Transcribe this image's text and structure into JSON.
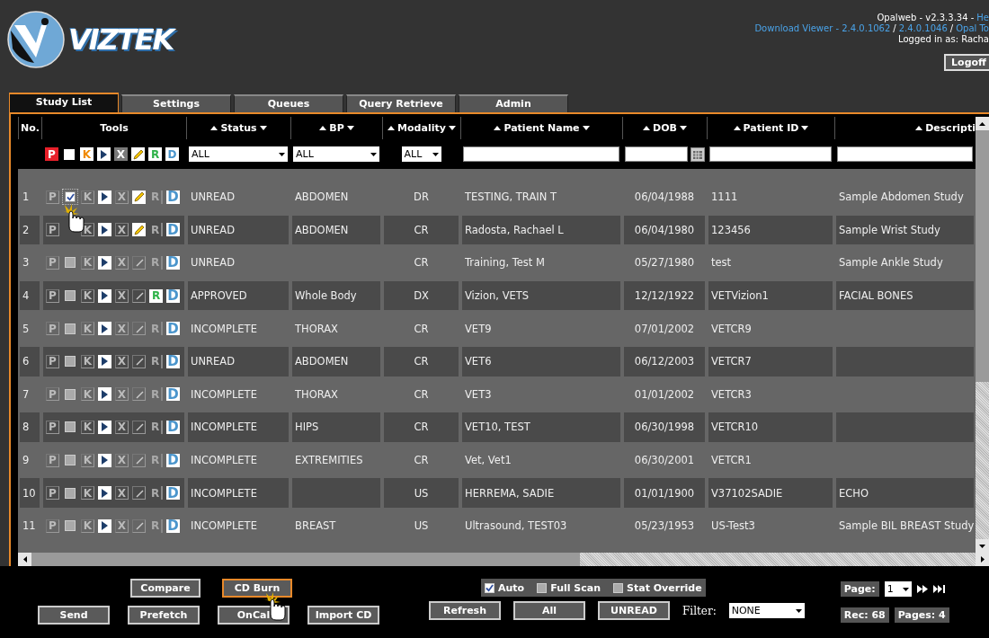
{
  "header": {
    "logo_text": "VIZTEK",
    "version": "Opalweb - v2.3.3.34 -",
    "help_link": "He",
    "download_links": [
      "Download Viewer - 2.4.0.1062",
      "2.4.0.1046",
      "Opal To"
    ],
    "separator": "/",
    "logged_in": "Logged in as: Racha",
    "logoff": "Logoff"
  },
  "tabs": [
    {
      "label": "Study List",
      "selected": true
    },
    {
      "label": "Settings",
      "selected": false
    },
    {
      "label": "Queues",
      "selected": false
    },
    {
      "label": "Query Retrieve",
      "selected": false
    },
    {
      "label": "Admin",
      "selected": false
    }
  ],
  "table": {
    "columns": [
      {
        "label": "No."
      },
      {
        "label": "Tools"
      },
      {
        "label": "Status",
        "sortable": true
      },
      {
        "label": "BP",
        "sortable": true
      },
      {
        "label": "Modality",
        "sortable": true
      },
      {
        "label": "Patient Name",
        "sortable": true
      },
      {
        "label": "DOB",
        "sortable": true
      },
      {
        "label": "Patient ID",
        "sortable": true
      },
      {
        "label": "Descripti",
        "sortable": true
      }
    ],
    "filter_tools": [
      {
        "kind": "filled",
        "label": "P",
        "color": "#e8202a"
      },
      {
        "kind": "check",
        "checked": false
      },
      {
        "kind": "colored",
        "label": "K",
        "color": "#f08a00"
      },
      {
        "kind": "play"
      },
      {
        "kind": "filled",
        "label": "X",
        "color": "#7a7a7a"
      },
      {
        "kind": "edit",
        "on": true
      },
      {
        "kind": "colored",
        "label": "R",
        "color": "#2fb34a"
      },
      {
        "kind": "colored",
        "label": "D",
        "color": "#4a95cc"
      }
    ],
    "filters": {
      "status": "ALL",
      "bp": "ALL",
      "modality": "ALL"
    },
    "rows": [
      {
        "no": "1",
        "tools": [
          {
            "kind": "outlined",
            "label": "P"
          },
          {
            "kind": "check",
            "checked": true
          },
          {
            "kind": "outlined",
            "label": "K"
          },
          {
            "kind": "play"
          },
          {
            "kind": "outlined",
            "label": "X"
          },
          {
            "kind": "edit",
            "on": true
          },
          {
            "kind": "report",
            "label": "R",
            "on": false
          },
          {
            "kind": "badge",
            "label": "D"
          }
        ],
        "status": "UNREAD",
        "bp": "ABDOMEN",
        "modality": "DR",
        "name": "TESTING, TRAIN T",
        "dob": "06/04/1988",
        "patient_id": "1111",
        "description": "Sample Abdomen Study"
      },
      {
        "no": "2",
        "tools": [
          {
            "kind": "outlined",
            "label": "P"
          },
          {
            "kind": "covered"
          },
          {
            "kind": "outlined",
            "label": "K"
          },
          {
            "kind": "play"
          },
          {
            "kind": "outlined",
            "label": "X"
          },
          {
            "kind": "edit",
            "on": true
          },
          {
            "kind": "report",
            "label": "R",
            "on": false
          },
          {
            "kind": "badge",
            "label": "D"
          }
        ],
        "status": "UNREAD",
        "bp": "ABDOMEN",
        "modality": "CR",
        "name": "Radosta, Rachael L",
        "dob": "06/04/1980",
        "patient_id": "123456",
        "description": "Sample Wrist Study"
      },
      {
        "no": "3",
        "tools": [
          {
            "kind": "outlined",
            "label": "P"
          },
          {
            "kind": "check",
            "checked": false
          },
          {
            "kind": "outlined",
            "label": "K"
          },
          {
            "kind": "play"
          },
          {
            "kind": "outlined",
            "label": "X"
          },
          {
            "kind": "edit",
            "on": false
          },
          {
            "kind": "report",
            "label": "R",
            "on": false
          },
          {
            "kind": "badge",
            "label": "D"
          }
        ],
        "status": "UNREAD",
        "modality": "CR",
        "name": "Training, Test M",
        "dob": "05/27/1980",
        "patient_id": "test",
        "description": "Sample Ankle Study"
      },
      {
        "no": "4",
        "tools": [
          {
            "kind": "outlined",
            "label": "P"
          },
          {
            "kind": "check",
            "checked": false
          },
          {
            "kind": "outlined",
            "label": "K"
          },
          {
            "kind": "play"
          },
          {
            "kind": "outlined",
            "label": "X"
          },
          {
            "kind": "edit",
            "on": false
          },
          {
            "kind": "report",
            "label": "R",
            "on": true
          },
          {
            "kind": "badge",
            "label": "D"
          }
        ],
        "status": "APPROVED",
        "bp": "Whole Body",
        "modality": "DX",
        "name": "Vizion, VETS",
        "dob": "12/12/1922",
        "patient_id": "VETVizion1",
        "description": "FACIAL BONES"
      },
      {
        "no": "5",
        "tools": [
          {
            "kind": "outlined",
            "label": "P"
          },
          {
            "kind": "check",
            "checked": false
          },
          {
            "kind": "outlined",
            "label": "K"
          },
          {
            "kind": "play"
          },
          {
            "kind": "outlined",
            "label": "X"
          },
          {
            "kind": "edit",
            "on": false
          },
          {
            "kind": "report",
            "label": "R",
            "on": false
          },
          {
            "kind": "badge",
            "label": "D"
          }
        ],
        "status": "INCOMPLETE",
        "bp": "THORAX",
        "modality": "CR",
        "name": "VET9",
        "dob": "07/01/2002",
        "patient_id": "VETCR9"
      },
      {
        "no": "6",
        "tools": [
          {
            "kind": "outlined",
            "label": "P"
          },
          {
            "kind": "check",
            "checked": false
          },
          {
            "kind": "outlined",
            "label": "K"
          },
          {
            "kind": "play"
          },
          {
            "kind": "outlined",
            "label": "X"
          },
          {
            "kind": "edit",
            "on": false
          },
          {
            "kind": "report",
            "label": "R",
            "on": false
          },
          {
            "kind": "badge",
            "label": "D"
          }
        ],
        "status": "UNREAD",
        "bp": "ABDOMEN",
        "modality": "CR",
        "name": "VET6",
        "dob": "06/12/2003",
        "patient_id": "VETCR7"
      },
      {
        "no": "7",
        "tools": [
          {
            "kind": "outlined",
            "label": "P"
          },
          {
            "kind": "check",
            "checked": false
          },
          {
            "kind": "outlined",
            "label": "K"
          },
          {
            "kind": "play"
          },
          {
            "kind": "outlined",
            "label": "X"
          },
          {
            "kind": "edit",
            "on": false
          },
          {
            "kind": "report",
            "label": "R",
            "on": false
          },
          {
            "kind": "badge",
            "label": "D"
          }
        ],
        "status": "INCOMPLETE",
        "bp": "THORAX",
        "modality": "CR",
        "name": "VET3",
        "dob": "01/01/2002",
        "patient_id": "VETCR3"
      },
      {
        "no": "8",
        "tools": [
          {
            "kind": "outlined",
            "label": "P"
          },
          {
            "kind": "check",
            "checked": false
          },
          {
            "kind": "outlined",
            "label": "K"
          },
          {
            "kind": "play"
          },
          {
            "kind": "outlined",
            "label": "X"
          },
          {
            "kind": "edit",
            "on": false
          },
          {
            "kind": "report",
            "label": "R",
            "on": false
          },
          {
            "kind": "badge",
            "label": "D"
          }
        ],
        "status": "INCOMPLETE",
        "bp": "HIPS",
        "modality": "CR",
        "name": "VET10, TEST",
        "dob": "06/30/1998",
        "patient_id": "VETCR10"
      },
      {
        "no": "9",
        "tools": [
          {
            "kind": "outlined",
            "label": "P"
          },
          {
            "kind": "check",
            "checked": false
          },
          {
            "kind": "outlined",
            "label": "K"
          },
          {
            "kind": "play"
          },
          {
            "kind": "outlined",
            "label": "X"
          },
          {
            "kind": "edit",
            "on": false
          },
          {
            "kind": "report",
            "label": "R",
            "on": false
          },
          {
            "kind": "badge",
            "label": "D"
          }
        ],
        "status": "INCOMPLETE",
        "bp": "EXTREMITIES",
        "modality": "CR",
        "name": "Vet, Vet1",
        "dob": "06/30/2001",
        "patient_id": "VETCR1"
      },
      {
        "no": "10",
        "tools": [
          {
            "kind": "outlined",
            "label": "P"
          },
          {
            "kind": "check",
            "checked": false
          },
          {
            "kind": "outlined",
            "label": "K"
          },
          {
            "kind": "play"
          },
          {
            "kind": "outlined",
            "label": "X"
          },
          {
            "kind": "edit",
            "on": false
          },
          {
            "kind": "report",
            "label": "R",
            "on": false
          },
          {
            "kind": "badge",
            "label": "D"
          }
        ],
        "status": "INCOMPLETE",
        "modality": "US",
        "name": "HERREMA, SADIE",
        "dob": "01/01/1900",
        "patient_id": "V37102SADIE",
        "description": "ECHO"
      },
      {
        "no": "11",
        "tools": [
          {
            "kind": "outlined",
            "label": "P"
          },
          {
            "kind": "check",
            "checked": false
          },
          {
            "kind": "outlined",
            "label": "K"
          },
          {
            "kind": "play"
          },
          {
            "kind": "outlined",
            "label": "X"
          },
          {
            "kind": "edit",
            "on": false
          },
          {
            "kind": "report",
            "label": "R",
            "on": false
          },
          {
            "kind": "badge",
            "label": "D"
          }
        ],
        "status": "INCOMPLETE",
        "bp": "BREAST",
        "modality": "US",
        "name": "Ultrasound, TEST03",
        "dob": "05/23/1953",
        "patient_id": "US-Test3",
        "description": "Sample BIL BREAST Study"
      }
    ]
  },
  "actions": {
    "row_1": [
      {
        "label": "Compare",
        "selected": false
      },
      {
        "label": "CD Burn",
        "selected": true
      }
    ],
    "row_2": [
      {
        "label": "Send",
        "selected": false
      },
      {
        "label": "Prefetch",
        "selected": false
      },
      {
        "label": "OnCal",
        "selected": false
      },
      {
        "label": "Import CD",
        "selected": false
      }
    ]
  },
  "options": [
    {
      "label": "Auto",
      "checked": true
    },
    {
      "label": "Full Scan",
      "checked": false
    },
    {
      "label": "Stat Override",
      "checked": false
    }
  ],
  "filter_buttons": [
    "Refresh",
    "All",
    "UNREAD"
  ],
  "filter": {
    "label": "Filter:",
    "value": "NONE"
  },
  "paging": {
    "page_label": "Page:",
    "page": "1",
    "records": "Rec: 68",
    "pages": "Pages: 4"
  }
}
